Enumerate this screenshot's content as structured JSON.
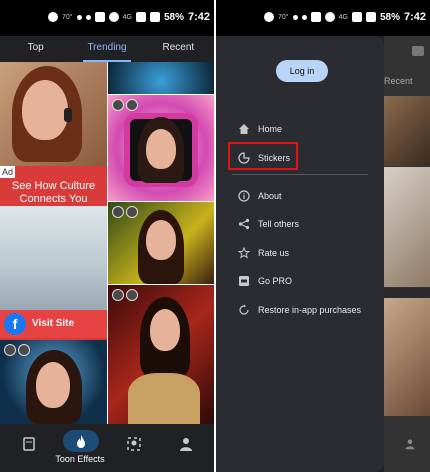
{
  "status_left": {
    "time": "7:42",
    "battery": "58%",
    "temp": "70°",
    "net": "4G"
  },
  "status_right": {
    "time": "7:42",
    "battery": "58%",
    "temp": "70°",
    "net": "4G"
  },
  "tabs": [
    {
      "label": "Top"
    },
    {
      "label": "Trending"
    },
    {
      "label": "Recent"
    }
  ],
  "ad": {
    "tag": "Ad",
    "headline": "See How Culture Connects You",
    "cta": "Visit Site",
    "fb_glyph": "f"
  },
  "bottom_nav": {
    "active_label": "Toon Effects"
  },
  "drawer": {
    "login_label": "Log in",
    "items": [
      {
        "label": "Home",
        "icon": "home-icon"
      },
      {
        "label": "Stickers",
        "icon": "sticker-icon"
      },
      {
        "label": "About",
        "icon": "info-icon"
      },
      {
        "label": "Tell others",
        "icon": "share-icon"
      },
      {
        "label": "Rate us",
        "icon": "star-icon"
      },
      {
        "label": "Go PRO",
        "icon": "pro-icon"
      },
      {
        "label": "Restore in-app purchases",
        "icon": "restore-icon"
      }
    ]
  },
  "right_bg": {
    "recent_label": "Recent"
  },
  "colors": {
    "accent": "#8ab4f8",
    "highlight": "#e01414",
    "login": "#b8d4f7"
  }
}
